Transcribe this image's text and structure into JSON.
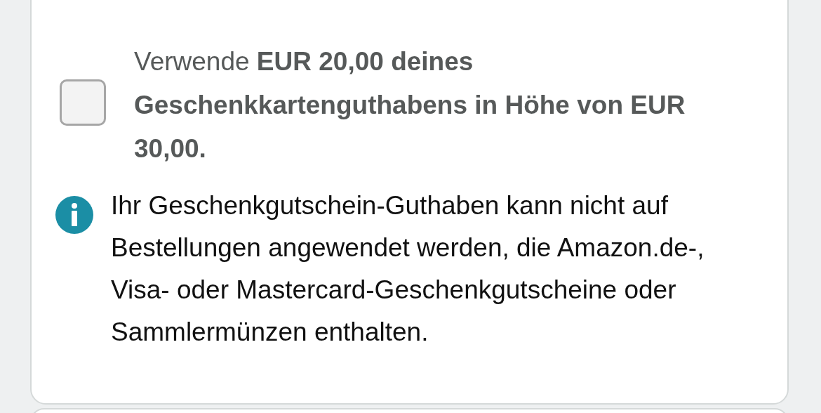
{
  "gift_card": {
    "checked": false,
    "label": "Verwende **EUR 20,00 deines Geschenkkartenguthabens in Höhe von EUR 30,00.**"
  },
  "info": {
    "text": "Ihr Geschenkgutschein-Guthaben kann nicht auf Bestellungen angewendet werden, die Amazon.de-, Visa- oder Mastercard-Geschenkgutscheine oder Sammlermünzen enthalten."
  }
}
